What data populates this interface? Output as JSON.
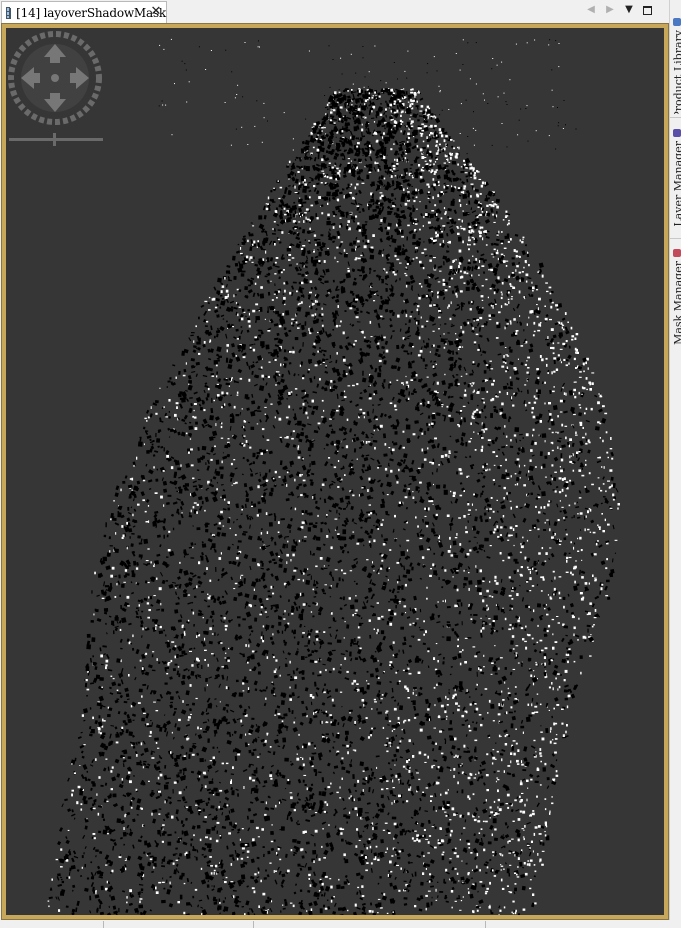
{
  "editor": {
    "tab_title": "[14] layoverShadowMask",
    "close_glyph": "✕",
    "tab_icon": "image-raster-icon"
  },
  "tab_controls": {
    "prev_glyph": "◀",
    "next_glyph": "▶",
    "menu_glyph": "▼",
    "maximize_icon": "maximize-icon"
  },
  "navigation": {
    "pan_control": "pan-compass-icon",
    "zoom_slider": "zoom-slider"
  },
  "side_panel": {
    "tabs": [
      {
        "label": "Product Library",
        "icon": "product-library-icon",
        "color": "#4a78c2"
      },
      {
        "label": "Layer Manager",
        "icon": "layer-manager-icon",
        "color": "#5a4fa8"
      },
      {
        "label": "Mask Manager",
        "icon": "mask-manager-icon",
        "color": "#c24a5a"
      }
    ]
  },
  "colors": {
    "frame": "#c7a85a",
    "background": "#363636",
    "mask_white": "#ffffff",
    "mask_black": "#000000"
  },
  "status": {
    "segments": [
      "",
      "",
      "",
      ""
    ]
  }
}
